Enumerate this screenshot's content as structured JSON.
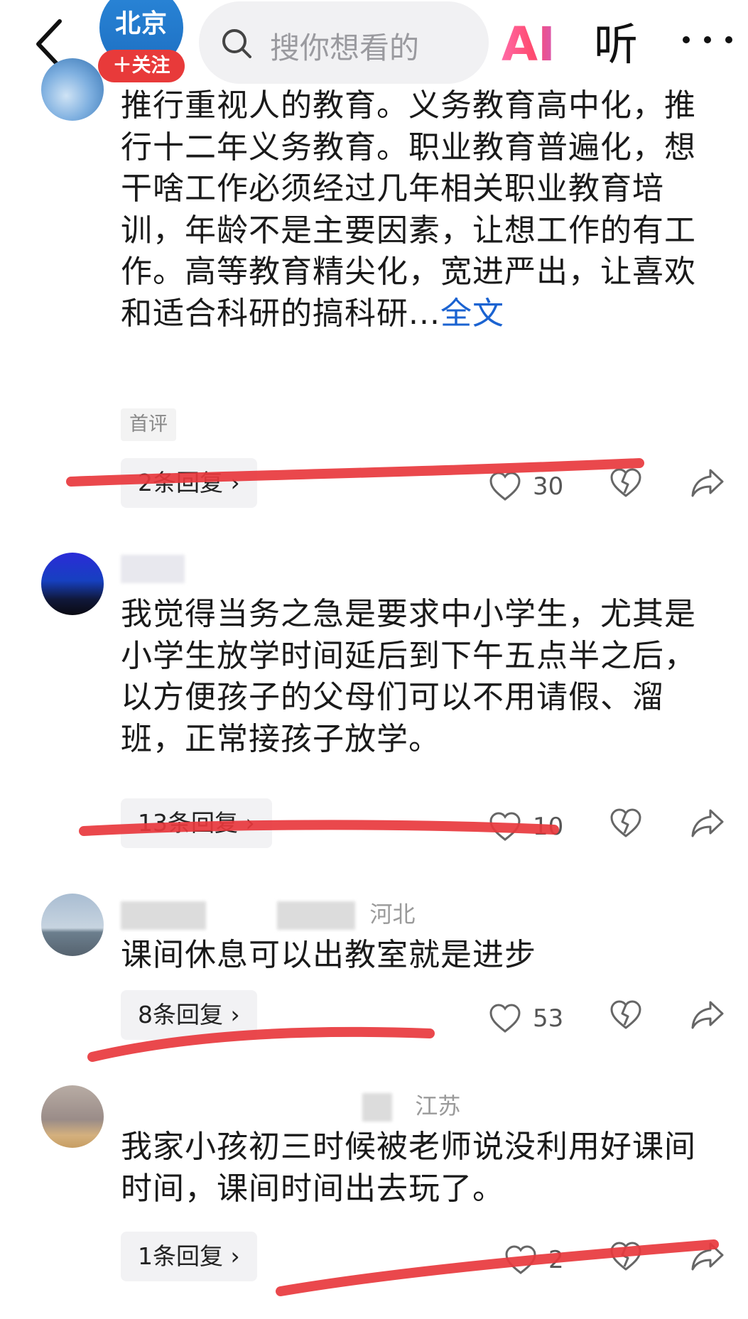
{
  "header": {
    "account_name": "北京",
    "follow_label": "＋关注",
    "search_placeholder": "搜你想看的",
    "ai_label": "AI",
    "listen_label": "听"
  },
  "comments": [
    {
      "name": "",
      "location": "",
      "text": "推行重视人的教育。义务教育高中化，推行十二年义务教育。职业教育普遍化，想干啥工作必须经过几年相关职业教育培训，年龄不是主要因素，让想工作的有工作。高等教育精尖化，宽进严出，让喜欢和适合科研的搞科研...",
      "more_label": "全文",
      "tag": "首评",
      "reply_label": "2条回复 ›",
      "likes": "30"
    },
    {
      "name": "",
      "location": "",
      "text": "我觉得当务之急是要求中小学生，尤其是小学生放学时间延后到下午五点半之后，以方便孩子的父母们可以不用请假、溜班，正常接孩子放学。",
      "reply_label": "13条回复 ›",
      "likes": "10"
    },
    {
      "name": "",
      "location": "河北",
      "text": "课间休息可以出教室就是进步",
      "reply_label": "8条回复 ›",
      "likes": "53"
    },
    {
      "name": "",
      "location": "江苏",
      "text": "我家小孩初三时候被老师说没利用好课间时间，课间时间出去玩了。",
      "reply_label": "1条回复 ›",
      "likes": "2"
    }
  ],
  "colors": {
    "accent_red": "#e83a3a",
    "link_blue": "#1b63d1",
    "annotation_red": "#e8383d"
  },
  "icons": [
    "back-arrow-icon",
    "search-icon",
    "more-dots-icon",
    "heart-icon",
    "broken-heart-icon",
    "share-icon"
  ]
}
